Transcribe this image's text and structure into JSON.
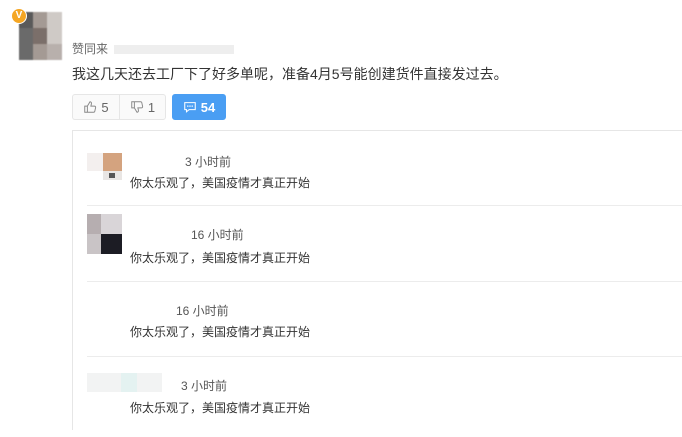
{
  "post": {
    "badge": "V",
    "author_prefix": "赞同来",
    "text": "我这几天还去工厂下了好多单呢，准备4月5号能创建货件直接发过去。",
    "like_count": "5",
    "dislike_count": "1",
    "comment_count": "54"
  },
  "comments": [
    {
      "time": "3 小时前",
      "text": "你太乐观了，美国疫情才真正开始"
    },
    {
      "time": "16 小时前",
      "text": "你太乐观了，美国疫情才真正开始"
    },
    {
      "time": "16 小时前",
      "text": "你太乐观了，美国疫情才真正开始"
    },
    {
      "time": "3 小时前",
      "text": "你太乐观了，美国疫情才真正开始"
    }
  ],
  "colors": {
    "accent": "#4a9ef3",
    "badge": "#f5a623"
  }
}
